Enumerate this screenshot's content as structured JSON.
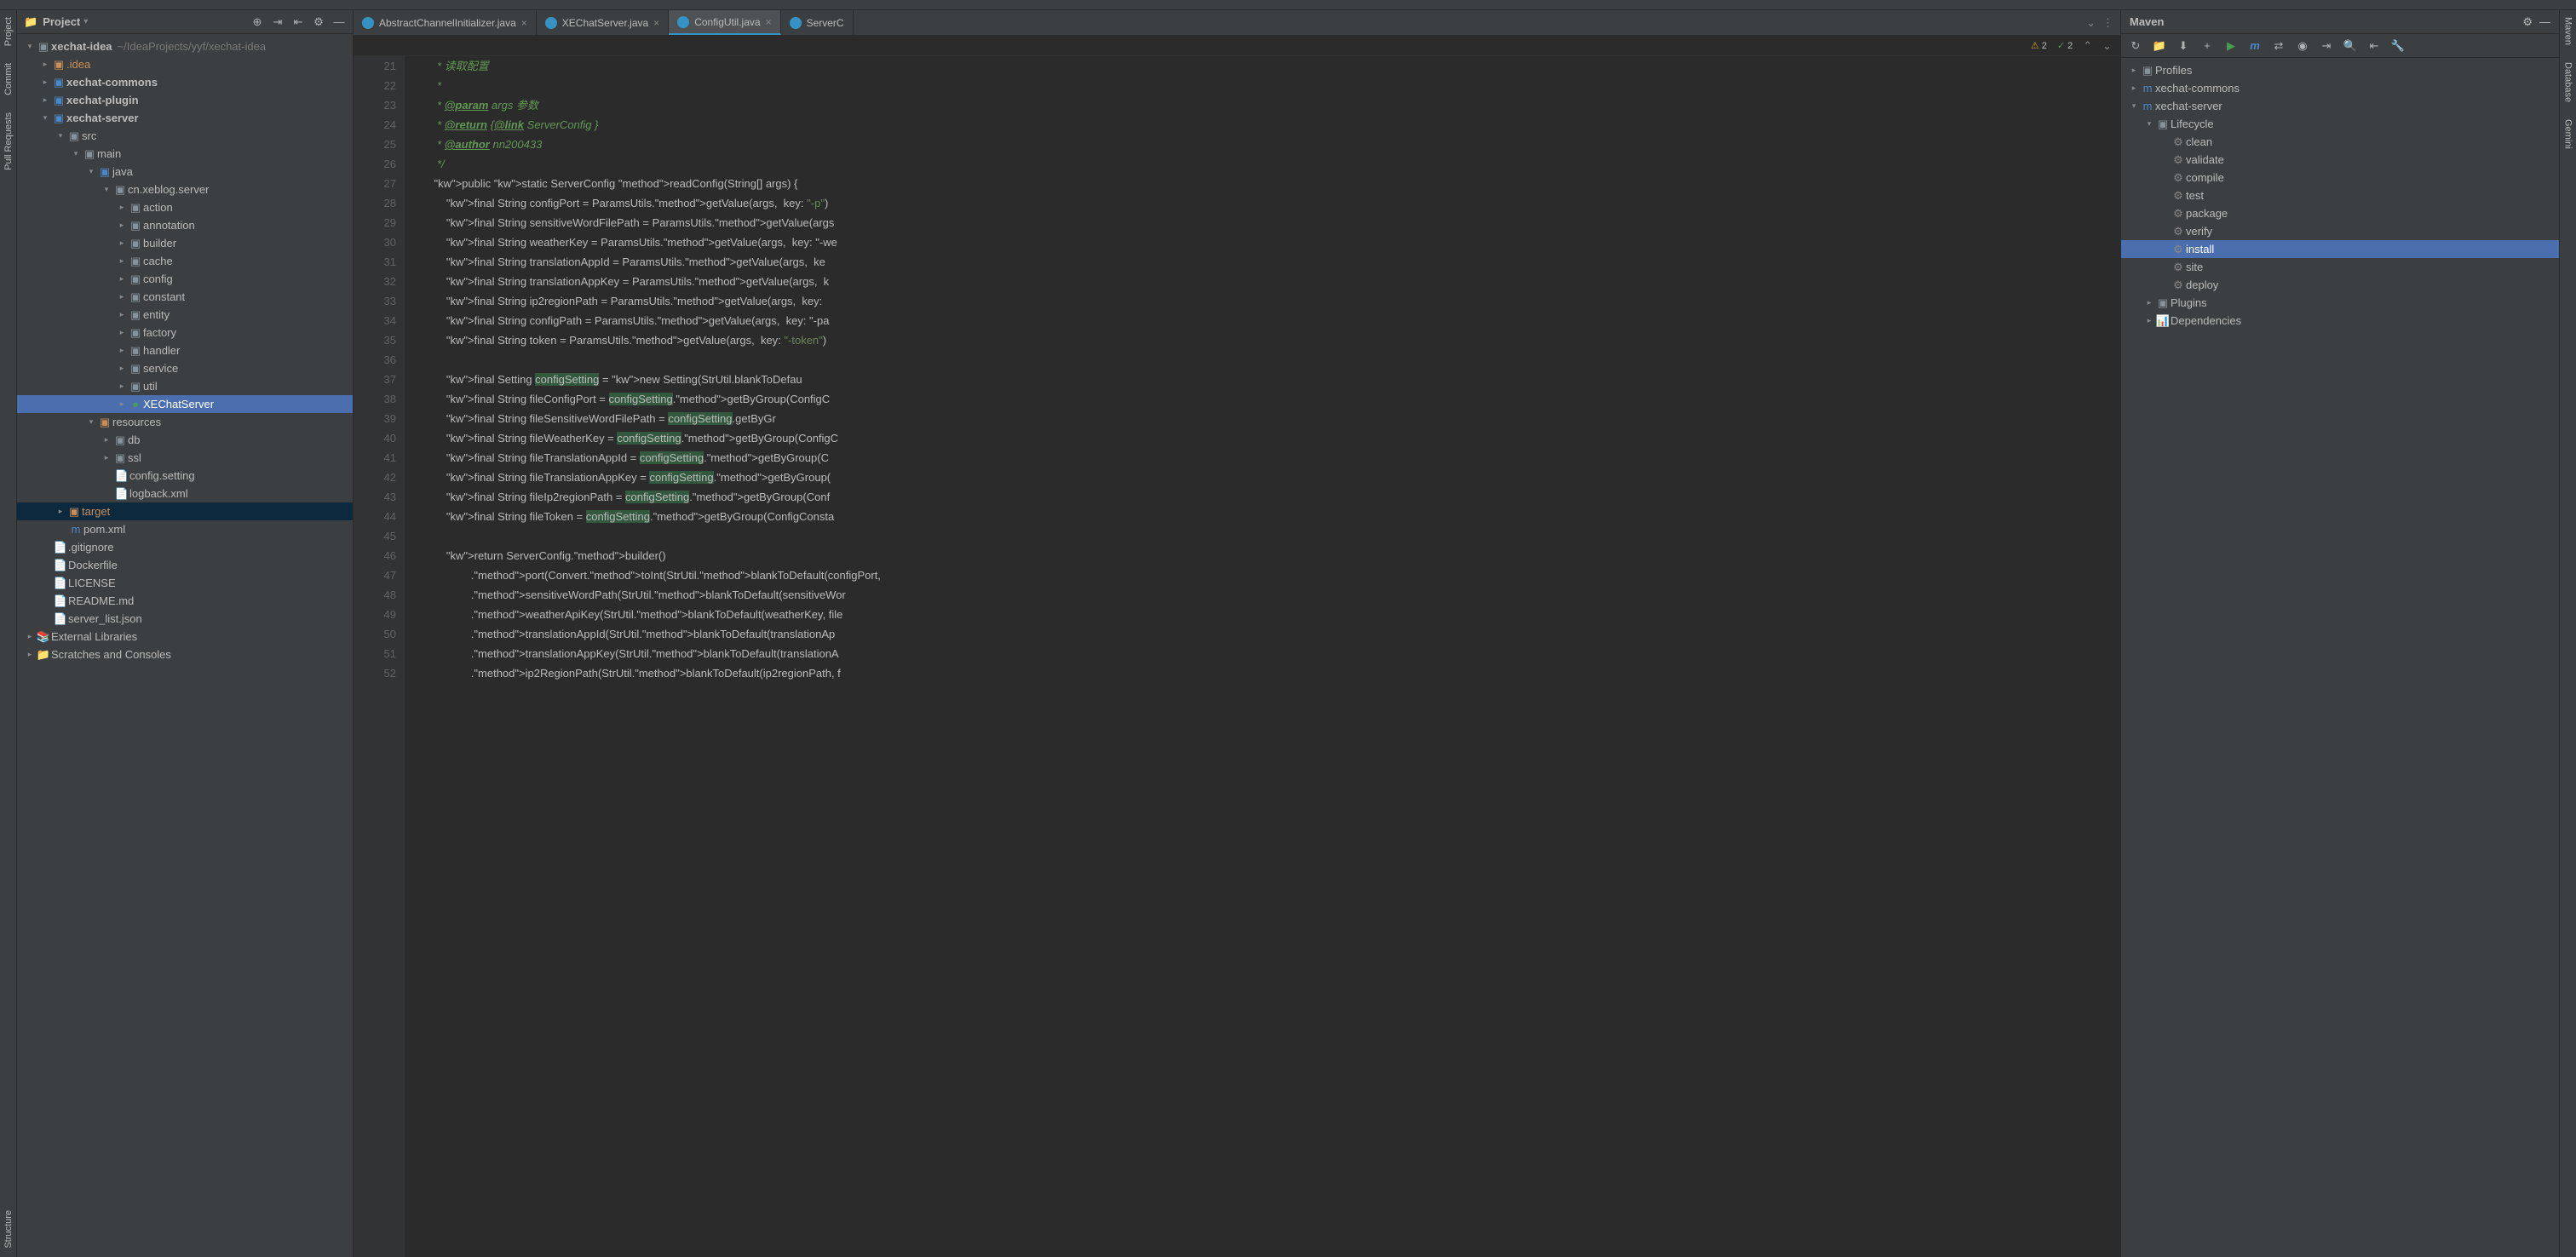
{
  "left_rail": {
    "project": "Project",
    "commit": "Commit",
    "pull_requests": "Pull Requests",
    "structure": "Structure"
  },
  "right_rail": {
    "maven": "Maven",
    "database": "Database",
    "gemini": "Gemini"
  },
  "project_panel": {
    "title": "Project",
    "root": {
      "name": "xechat-idea",
      "path": "~/IdeaProjects/yyf/xechat-idea"
    },
    "nodes": {
      "idea": ".idea",
      "commons": "xechat-commons",
      "plugin": "xechat-plugin",
      "server": "xechat-server",
      "src": "src",
      "main_dir": "main",
      "java_dir": "java",
      "pkg": "cn.xeblog.server",
      "action": "action",
      "annotation": "annotation",
      "builder": "builder",
      "cache": "cache",
      "config": "config",
      "constant": "constant",
      "entity": "entity",
      "factory": "factory",
      "handler": "handler",
      "service": "service",
      "util": "util",
      "xechatserver": "XEChatServer",
      "resources": "resources",
      "db": "db",
      "ssl": "ssl",
      "configsetting": "config.setting",
      "logback": "logback.xml",
      "target": "target",
      "pom": "pom.xml",
      "gitignore": ".gitignore",
      "dockerfile": "Dockerfile",
      "license": "LICENSE",
      "readme": "README.md",
      "serverlist": "server_list.json",
      "extlibs": "External Libraries",
      "scratches": "Scratches and Consoles"
    }
  },
  "tabs": [
    {
      "label": "AbstractChannelInitializer.java"
    },
    {
      "label": "XEChatServer.java"
    },
    {
      "label": "ConfigUtil.java"
    },
    {
      "label": "ServerC"
    }
  ],
  "editor_status": {
    "warnings": "2",
    "checks": "2"
  },
  "code": {
    "first_line": 21,
    "lines": [
      "     * 读取配置",
      "     *",
      "     * @param args 参数",
      "     * @return {@link ServerConfig }",
      "     * @author nn200433",
      "     */",
      "    public static ServerConfig readConfig(String[] args) {",
      "        final String configPort = ParamsUtils.getValue(args,  key: \"-p\")",
      "        final String sensitiveWordFilePath = ParamsUtils.getValue(args",
      "        final String weatherKey = ParamsUtils.getValue(args,  key: \"-we",
      "        final String translationAppId = ParamsUtils.getValue(args,  ke",
      "        final String translationAppKey = ParamsUtils.getValue(args,  k",
      "        final String ip2regionPath = ParamsUtils.getValue(args,  key: ",
      "        final String configPath = ParamsUtils.getValue(args,  key: \"-pa",
      "        final String token = ParamsUtils.getValue(args,  key: \"-token\")",
      "",
      "        final Setting configSetting = new Setting(StrUtil.blankToDefau",
      "        final String fileConfigPort = configSetting.getByGroup(ConfigC",
      "        final String fileSensitiveWordFilePath = configSetting.getByGr",
      "        final String fileWeatherKey = configSetting.getByGroup(ConfigC",
      "        final String fileTranslationAppId = configSetting.getByGroup(C",
      "        final String fileTranslationAppKey = configSetting.getByGroup(",
      "        final String fileIp2regionPath = configSetting.getByGroup(Conf",
      "        final String fileToken = configSetting.getByGroup(ConfigConsta",
      "",
      "        return ServerConfig.builder()",
      "                .port(Convert.toInt(StrUtil.blankToDefault(configPort,",
      "                .sensitiveWordPath(StrUtil.blankToDefault(sensitiveWor",
      "                .weatherApiKey(StrUtil.blankToDefault(weatherKey, file",
      "                .translationAppId(StrUtil.blankToDefault(translationAp",
      "                .translationAppKey(StrUtil.blankToDefault(translationA",
      "                .ip2RegionPath(StrUtil.blankToDefault(ip2regionPath, f"
    ]
  },
  "maven": {
    "title": "Maven",
    "profiles": "Profiles",
    "commons": "xechat-commons",
    "server": "xechat-server",
    "lifecycle": "Lifecycle",
    "goals": [
      "clean",
      "validate",
      "compile",
      "test",
      "package",
      "verify",
      "install",
      "site",
      "deploy"
    ],
    "plugins": "Plugins",
    "dependencies": "Dependencies"
  }
}
